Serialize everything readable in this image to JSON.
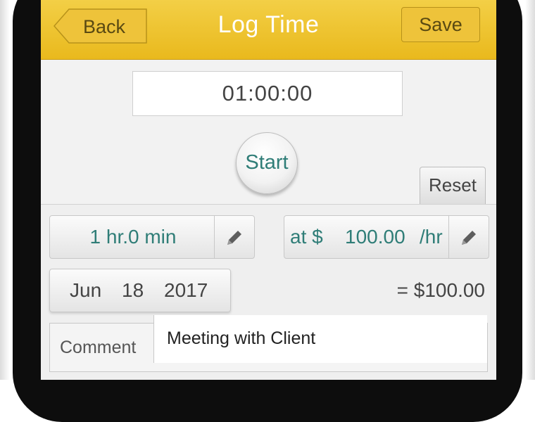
{
  "navbar": {
    "title": "Log Time",
    "back_label": "Back",
    "save_label": "Save"
  },
  "timer": {
    "display": "01:00:00",
    "start_label": "Start",
    "reset_label": "Reset"
  },
  "entry": {
    "duration": "1 hr.0 min",
    "rate_prefix": "at $",
    "rate_amount": "100.00",
    "rate_unit": "/hr",
    "date_month": "Jun",
    "date_day": "18",
    "date_year": "2017",
    "total": "= $100.00",
    "comment_label": "Comment",
    "comment_value": "Meeting with Client"
  },
  "colors": {
    "navbar": "#efc534",
    "accent_text": "#2f7d77",
    "background": "#efefef"
  },
  "icons": {
    "edit": "pencil-icon",
    "back": "back-arrow-button-shape"
  }
}
